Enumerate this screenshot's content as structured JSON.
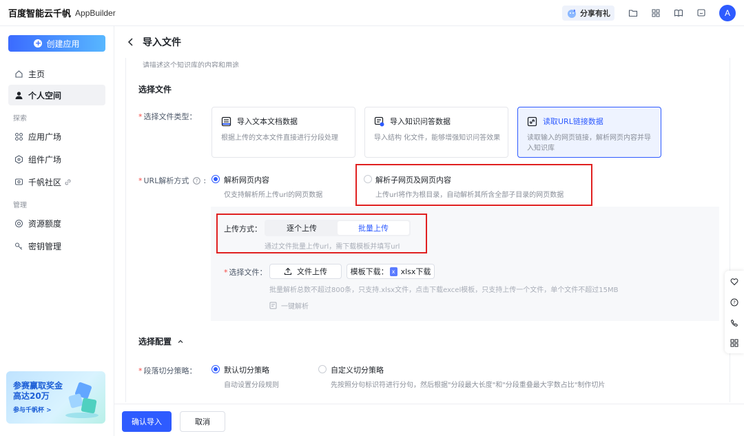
{
  "app": {
    "logo_cn": "百度智能云千帆",
    "logo_en": "AppBuilder"
  },
  "topbar": {
    "share_label": "分享有礼",
    "avatar_letter": "A"
  },
  "sidebar": {
    "create_label": "创建应用",
    "items": [
      {
        "label": "主页",
        "icon": "home-icon"
      },
      {
        "label": "个人空间",
        "icon": "user-icon"
      },
      {
        "label": "应用广场",
        "icon": "apps-icon"
      },
      {
        "label": "组件广场",
        "icon": "component-icon"
      },
      {
        "label": "千帆社区",
        "icon": "community-icon"
      },
      {
        "label": "资源额度",
        "icon": "resource-icon"
      },
      {
        "label": "密钥管理",
        "icon": "key-icon"
      }
    ],
    "section_explore": "探索",
    "section_manage": "管理",
    "promo": {
      "line1": "参赛赢取奖金",
      "line2": "高达20万",
      "link": "参与千帆杯 >"
    }
  },
  "page": {
    "title": "导入文件",
    "cut_text": "请描述这个知识库的内容和用途"
  },
  "select_file": {
    "section_title": "选择文件",
    "type_label": "选择文件类型：",
    "cards": [
      {
        "title": "导入文本文档数据",
        "desc": "根据上传的文本文件直接进行分段处理",
        "icon": "document-icon"
      },
      {
        "title": "导入知识问答数据",
        "desc": "导入结构 化文件，能够增强知识问答效果",
        "icon": "qa-icon"
      },
      {
        "title": "读取URL链接数据",
        "desc": "读取输入的网页链接，解析网页内容并导入知识库",
        "icon": "link-icon"
      }
    ],
    "url_mode_label": "URL解析方式",
    "url_modes": [
      {
        "title": "解析网页内容",
        "desc": "仅支持解析所上传url的网页数据",
        "selected": true
      },
      {
        "title": "解析子网页及网页内容",
        "desc": "上传url将作为根目录，自动解析其所含全部子目录的网页数据",
        "selected": false
      }
    ],
    "upload_mode_label": "上传方式：",
    "upload_modes": [
      "逐个上传",
      "批量上传"
    ],
    "upload_mode_hint": "通过文件批量上传url，需下载模板并填写url",
    "choose_file_label": "选择文件：",
    "upload_btn": "文件上传",
    "template_label": "模板下载：",
    "template_file": "xlsx下载",
    "file_hint": "批量解析总数不超过800条，只支持.xlsx文件，点击下载excel模板，只支持上传一个文件，单个文件不超过15MB",
    "one_click_parse": "一键解析"
  },
  "config": {
    "section_title": "选择配置",
    "split_label": "段落切分策略：",
    "split_modes": [
      {
        "title": "默认切分策略",
        "desc": "自动设置分段规则",
        "selected": true
      },
      {
        "title": "自定义切分策略",
        "desc": "先按照分句标识符进行分句，然后根据\"分段最大长度\"和\"分段重叠最大字数占比\"制作切片",
        "selected": false
      }
    ]
  },
  "footer": {
    "confirm": "确认导入",
    "cancel": "取消"
  },
  "colors": {
    "accent": "#2e5bff",
    "highlight": "#e02020"
  }
}
